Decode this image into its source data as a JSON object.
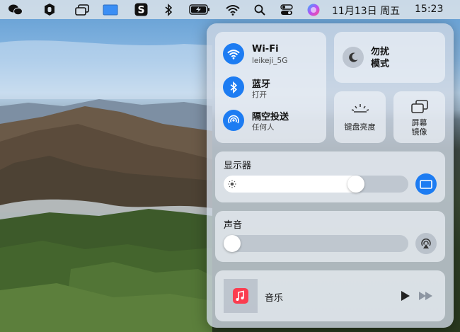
{
  "menubar": {
    "icons": [
      "wechat-icon",
      "shield-icon",
      "window-icon",
      "display-icon",
      "s-app-icon",
      "bluetooth-icon",
      "battery-icon",
      "wifi-icon",
      "search-icon",
      "control-center-icon",
      "siri-icon"
    ],
    "date": "11月13日 周五",
    "time": "15:23"
  },
  "control_center": {
    "wifi": {
      "title": "Wi-Fi",
      "subtitle": "leikeji_5G"
    },
    "bluetooth": {
      "title": "蓝牙",
      "subtitle": "打开"
    },
    "airdrop": {
      "title": "隔空投送",
      "subtitle": "任何人"
    },
    "dnd": {
      "line1": "勿扰",
      "line2": "模式"
    },
    "keyboard_brightness": {
      "label": "键盘亮度"
    },
    "screen_mirroring": {
      "line1": "屏幕",
      "line2": "镜像"
    },
    "display": {
      "title": "显示器",
      "brightness": 0.74
    },
    "sound": {
      "title": "声音",
      "volume": 0.0
    },
    "music": {
      "title": "音乐"
    }
  },
  "colors": {
    "accent": "#1d7cf2",
    "music_red": "#fb3c4f"
  }
}
